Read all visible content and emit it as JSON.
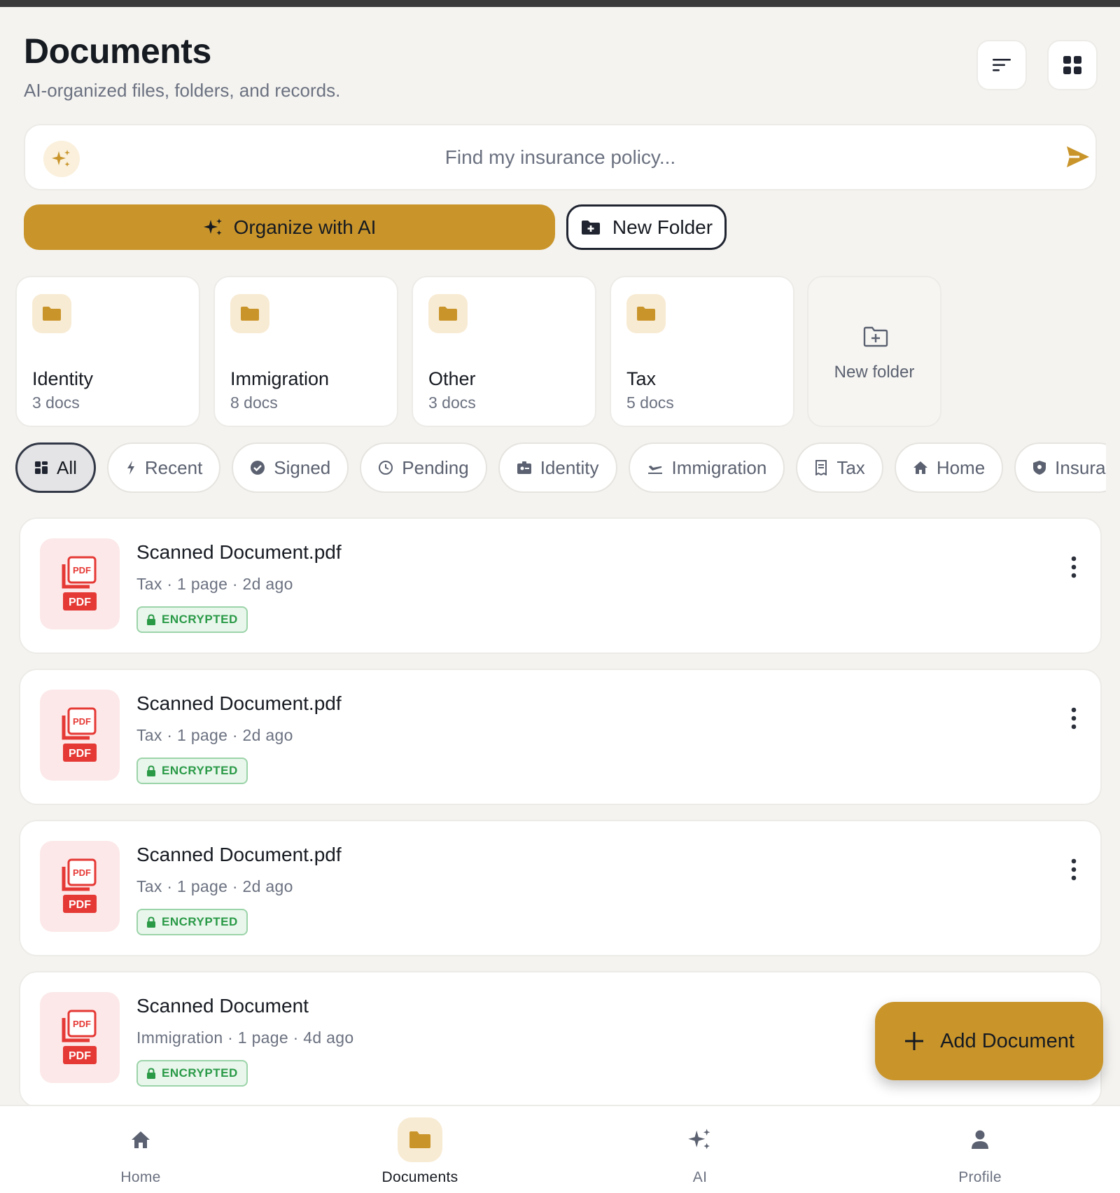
{
  "header": {
    "title": "Documents",
    "subtitle": "AI-organized files, folders, and records.",
    "sort_icon": "sort-icon",
    "grid_icon": "grid-view-icon"
  },
  "search": {
    "placeholder": "Find my insurance policy..."
  },
  "actions": {
    "organize_label": "Organize with AI",
    "new_folder_label": "New Folder"
  },
  "folders": [
    {
      "name": "Identity",
      "count": "3 docs"
    },
    {
      "name": "Immigration",
      "count": "8 docs"
    },
    {
      "name": "Other",
      "count": "3 docs"
    },
    {
      "name": "Tax",
      "count": "5 docs"
    }
  ],
  "new_folder_card": {
    "label": "New folder"
  },
  "filters": [
    {
      "label": "All",
      "icon": "grid-icon",
      "active": true
    },
    {
      "label": "Recent",
      "icon": "bolt-icon"
    },
    {
      "label": "Signed",
      "icon": "check-circle-icon"
    },
    {
      "label": "Pending",
      "icon": "clock-icon"
    },
    {
      "label": "Identity",
      "icon": "id-badge-icon"
    },
    {
      "label": "Immigration",
      "icon": "plane-icon"
    },
    {
      "label": "Tax",
      "icon": "receipt-icon"
    },
    {
      "label": "Home",
      "icon": "home-icon"
    },
    {
      "label": "Insura",
      "icon": "shield-icon"
    }
  ],
  "documents": [
    {
      "name": "Scanned Document.pdf",
      "meta": "Tax · 1 page · 2d ago",
      "badge": "ENCRYPTED",
      "thumb_label": "PDF"
    },
    {
      "name": "Scanned Document.pdf",
      "meta": "Tax · 1 page · 2d ago",
      "badge": "ENCRYPTED",
      "thumb_label": "PDF"
    },
    {
      "name": "Scanned Document.pdf",
      "meta": "Tax · 1 page · 2d ago",
      "badge": "ENCRYPTED",
      "thumb_label": "PDF"
    },
    {
      "name": "Scanned Document",
      "meta": "Immigration · 1 page · 4d ago",
      "badge": "ENCRYPTED",
      "thumb_label": "PDF"
    }
  ],
  "fab": {
    "label": "Add Document"
  },
  "nav": [
    {
      "label": "Home",
      "icon": "home-icon"
    },
    {
      "label": "Documents",
      "icon": "folder-icon",
      "active": true
    },
    {
      "label": "AI",
      "icon": "sparkle-icon"
    },
    {
      "label": "Profile",
      "icon": "person-icon"
    }
  ],
  "colors": {
    "accent": "#c9952b",
    "background": "#f4f3f0",
    "encrypted_green": "#2a9a47",
    "pdf_red": "#e53935"
  }
}
